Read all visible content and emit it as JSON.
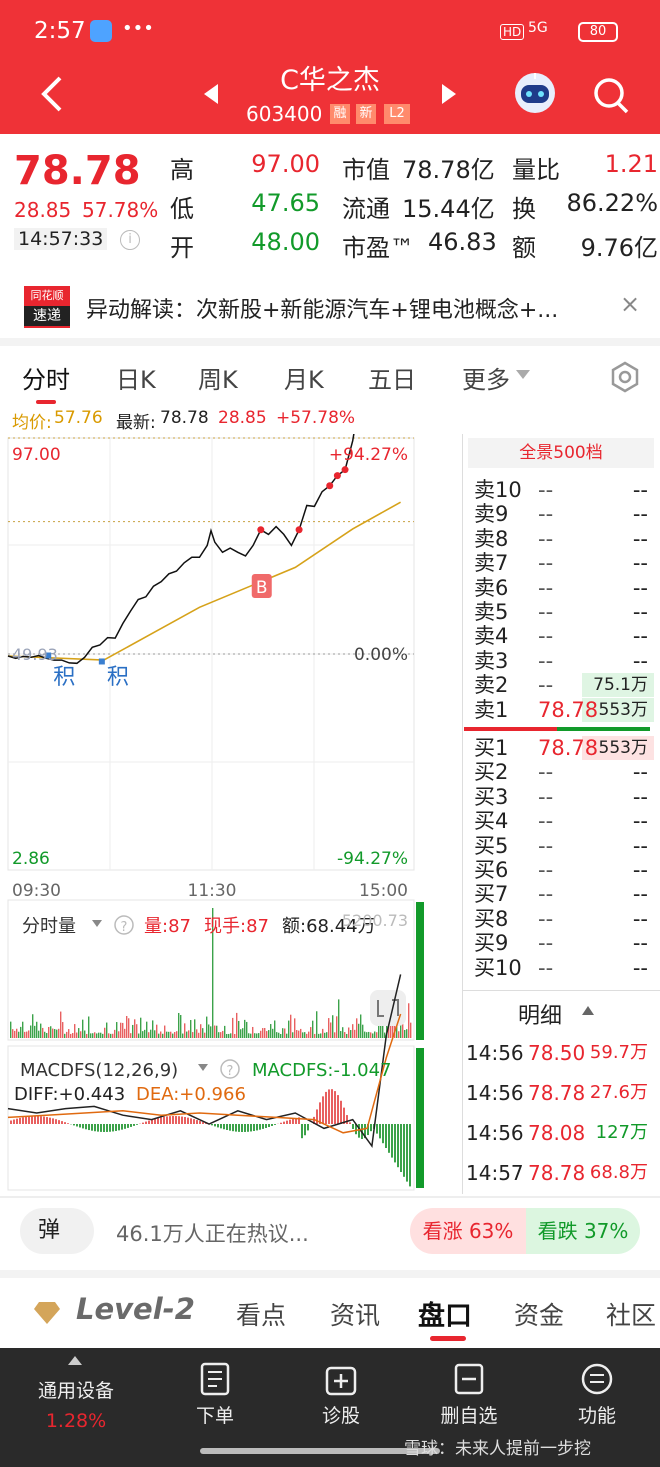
{
  "status_bar": {
    "time": "2:57",
    "network": "5G",
    "battery": "80"
  },
  "header": {
    "name": "C华之杰",
    "code": "603400",
    "badges": [
      "融",
      "新",
      "L2"
    ]
  },
  "quote": {
    "price": "78.78",
    "change": "28.85",
    "change_pct": "57.78%",
    "time": "14:57:33",
    "stats": [
      {
        "label": "高",
        "value": "97.00",
        "color": "#e8262f"
      },
      {
        "label": "低",
        "value": "47.65",
        "color": "#129a2a"
      },
      {
        "label": "开",
        "value": "48.00",
        "color": "#129a2a"
      },
      {
        "label": "市值",
        "value": "78.78亿",
        "color": "#222"
      },
      {
        "label": "流通",
        "value": "15.44亿",
        "color": "#222"
      },
      {
        "label": "市盈™",
        "value": "46.83",
        "color": "#222"
      },
      {
        "label": "量比",
        "value": "1.21",
        "color": "#e8262f"
      },
      {
        "label": "换",
        "value": "86.22%",
        "color": "#222"
      },
      {
        "label": "额",
        "value": "9.76亿",
        "color": "#222"
      }
    ]
  },
  "news": {
    "logo_top": "同花顺",
    "logo_bottom": "速递",
    "text": "异动解读：次新股+新能源汽车+锂电池概念+..."
  },
  "tabs": [
    "分时",
    "日K",
    "周K",
    "月K",
    "五日",
    "更多"
  ],
  "chart_legend": {
    "avg_label": "均价:",
    "avg_value": "57.76",
    "latest_label": "最新:",
    "latest_value": "78.78",
    "change": "28.85",
    "change_pct": "+57.78%"
  },
  "chart_data": {
    "type": "line",
    "price_axis": {
      "top": "97.00",
      "bottom": "2.86",
      "pct_top": "+94.27%",
      "pct_mid": "0.00%",
      "pct_bottom": "-94.27%",
      "prev_close_label": "49.93"
    },
    "x_ticks": [
      "09:30",
      "11:30",
      "15:00"
    ],
    "ylim": [
      2.86,
      97.0
    ],
    "price_series": [
      [
        0,
        49.5
      ],
      [
        8,
        49.0
      ],
      [
        16,
        49.4
      ],
      [
        24,
        49.2
      ],
      [
        32,
        49.6
      ],
      [
        40,
        49.0
      ],
      [
        48,
        48.6
      ],
      [
        56,
        48.6
      ],
      [
        64,
        48.0
      ],
      [
        72,
        47.9
      ],
      [
        80,
        49.2
      ],
      [
        88,
        51.4
      ],
      [
        96,
        51.9
      ],
      [
        104,
        53.5
      ],
      [
        112,
        53.4
      ],
      [
        120,
        56.6
      ],
      [
        128,
        59.3
      ],
      [
        136,
        61.8
      ],
      [
        144,
        62.4
      ],
      [
        152,
        64.7
      ],
      [
        160,
        65.7
      ],
      [
        168,
        67.4
      ],
      [
        176,
        68.0
      ],
      [
        184,
        69.8
      ],
      [
        192,
        71.0
      ],
      [
        200,
        71.0
      ],
      [
        208,
        73.6
      ],
      [
        212,
        76.8
      ],
      [
        216,
        74.3
      ],
      [
        224,
        72.1
      ],
      [
        232,
        73.0
      ],
      [
        240,
        72.1
      ],
      [
        248,
        71.3
      ],
      [
        256,
        73.6
      ],
      [
        264,
        77.0
      ],
      [
        272,
        76.0
      ],
      [
        280,
        77.7
      ],
      [
        288,
        76.0
      ],
      [
        296,
        73.6
      ],
      [
        304,
        77.0
      ],
      [
        312,
        82.3
      ],
      [
        320,
        82.1
      ],
      [
        328,
        85.3
      ],
      [
        336,
        86.6
      ],
      [
        344,
        88.8
      ],
      [
        352,
        90.1
      ],
      [
        360,
        96.4
      ],
      [
        366,
        104.0
      ],
      [
        372,
        117.5
      ],
      [
        378,
        139.0
      ],
      [
        382,
        117.0
      ],
      [
        386,
        103.4
      ],
      [
        390,
        110.5
      ],
      [
        394,
        101.9
      ],
      [
        398,
        110.5
      ],
      [
        402,
        104.6
      ],
      [
        406,
        110.5
      ],
      [
        412,
        114.9
      ],
      [
        424,
        114.9
      ]
    ],
    "avg_series": [
      [
        0,
        49.5
      ],
      [
        100,
        48.6
      ],
      [
        200,
        60.1
      ],
      [
        300,
        68.8
      ],
      [
        360,
        77.2
      ],
      [
        410,
        83.0
      ]
    ],
    "markers": [
      {
        "label": "积",
        "x": 42
      },
      {
        "label": "积",
        "x": 98
      },
      {
        "label": "B",
        "x": 265
      }
    ],
    "volume": {
      "label": "分时量",
      "volume": "量:87",
      "hand": "现手:87",
      "amount": "额:68.44万",
      "max": "5200.73"
    },
    "macd": {
      "label": "MACDFS(12,26,9)",
      "value_label": "MACDFS:-1.047",
      "diff": "DIFF:+0.443",
      "dea": "DEA:+0.966",
      "dif_series": [
        [
          0,
          1067
        ],
        [
          30,
          1065
        ],
        [
          60,
          1067
        ],
        [
          90,
          1068
        ],
        [
          120,
          1064
        ],
        [
          150,
          1062
        ],
        [
          180,
          1066
        ],
        [
          210,
          1060
        ],
        [
          240,
          1066
        ],
        [
          270,
          1062
        ],
        [
          300,
          1065
        ],
        [
          330,
          1058
        ],
        [
          360,
          1062
        ],
        [
          380,
          1050
        ],
        [
          395,
          1100
        ],
        [
          410,
          1128
        ]
      ],
      "dea_series": [
        [
          0,
          1063
        ],
        [
          40,
          1064
        ],
        [
          80,
          1065
        ],
        [
          120,
          1066
        ],
        [
          160,
          1064
        ],
        [
          200,
          1065
        ],
        [
          240,
          1064
        ],
        [
          280,
          1063
        ],
        [
          320,
          1062
        ],
        [
          350,
          1056
        ],
        [
          375,
          1058
        ],
        [
          395,
          1090
        ],
        [
          410,
          1110
        ]
      ]
    }
  },
  "order_book": {
    "header": "全景500档",
    "asks": [
      {
        "label": "卖10",
        "price": "--",
        "vol": "--"
      },
      {
        "label": "卖9",
        "price": "--",
        "vol": "--"
      },
      {
        "label": "卖8",
        "price": "--",
        "vol": "--"
      },
      {
        "label": "卖7",
        "price": "--",
        "vol": "--"
      },
      {
        "label": "卖6",
        "price": "--",
        "vol": "--"
      },
      {
        "label": "卖5",
        "price": "--",
        "vol": "--"
      },
      {
        "label": "卖4",
        "price": "--",
        "vol": "--"
      },
      {
        "label": "卖3",
        "price": "--",
        "vol": "--"
      },
      {
        "label": "卖2",
        "price": "--",
        "vol": "75.1万"
      },
      {
        "label": "卖1",
        "price": "78.78",
        "vol": "553万"
      }
    ],
    "bids": [
      {
        "label": "买1",
        "price": "78.78",
        "vol": "553万"
      },
      {
        "label": "买2",
        "price": "--",
        "vol": "--"
      },
      {
        "label": "买3",
        "price": "--",
        "vol": "--"
      },
      {
        "label": "买4",
        "price": "--",
        "vol": "--"
      },
      {
        "label": "买5",
        "price": "--",
        "vol": "--"
      },
      {
        "label": "买6",
        "price": "--",
        "vol": "--"
      },
      {
        "label": "买7",
        "price": "--",
        "vol": "--"
      },
      {
        "label": "买8",
        "price": "--",
        "vol": "--"
      },
      {
        "label": "买9",
        "price": "--",
        "vol": "--"
      },
      {
        "label": "买10",
        "price": "--",
        "vol": "--"
      }
    ],
    "detail_label": "明细",
    "trades": [
      {
        "time": "14:56",
        "price": "78.50",
        "vol": "59.7万",
        "pcolor": "#e8262f",
        "vcolor": "#e8262f"
      },
      {
        "time": "14:56",
        "price": "78.78",
        "vol": "27.6万",
        "pcolor": "#e8262f",
        "vcolor": "#e8262f"
      },
      {
        "time": "14:56",
        "price": "78.08",
        "vol": "127万",
        "pcolor": "#e8262f",
        "vcolor": "#129a2a"
      },
      {
        "time": "14:57",
        "price": "78.78",
        "vol": "68.8万",
        "pcolor": "#e8262f",
        "vcolor": "#e8262f"
      }
    ]
  },
  "hot": {
    "danmu": "弹",
    "text": "46.1万人正在热议...",
    "up": "看涨 63%",
    "down": "看跌 37%",
    "up_pct": 63
  },
  "bottom_tabs": [
    "Level-2",
    "看点",
    "资讯",
    "盘口",
    "资金",
    "社区"
  ],
  "toolbar": {
    "device": "通用设备",
    "device_pct": "1.28%",
    "items": [
      "下单",
      "诊股",
      "删自选",
      "功能"
    ]
  },
  "watermark": "雪球：未来人提前一步挖"
}
